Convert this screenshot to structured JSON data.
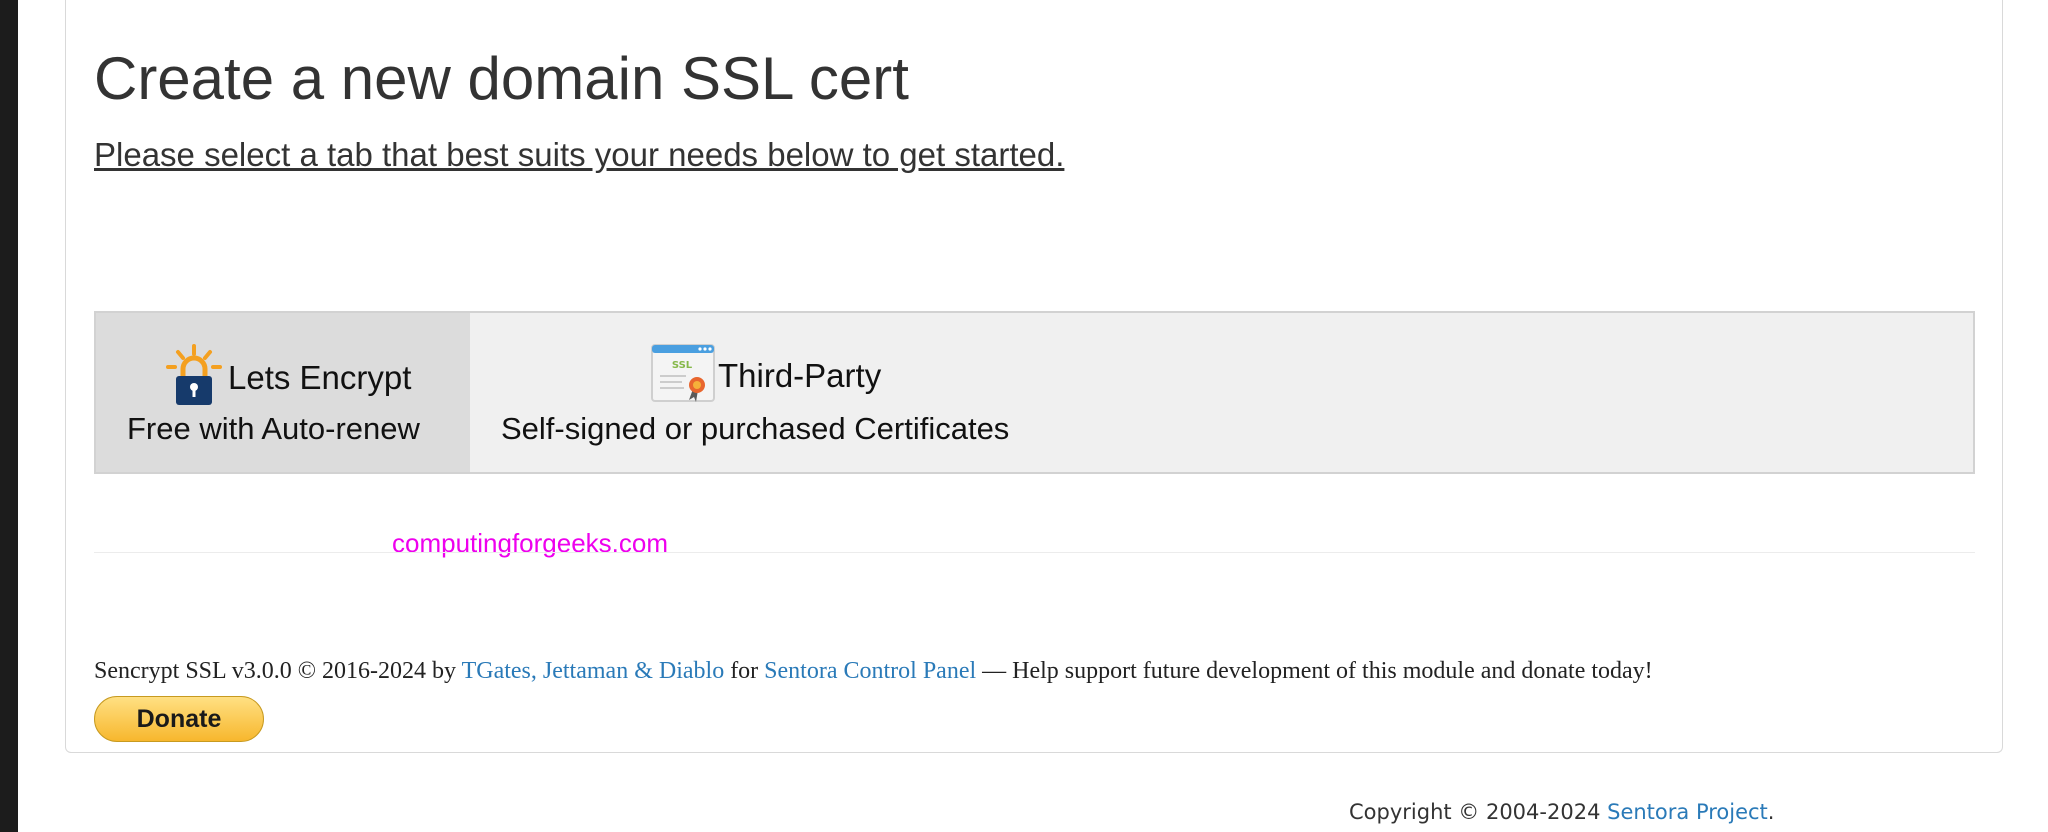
{
  "page": {
    "title": "Create a new domain SSL cert",
    "subtitle": "Please select a tab that best suits your needs below to get started."
  },
  "tabs": [
    {
      "title": "Lets Encrypt",
      "subtitle": "Free with Auto-renew",
      "icon": "lets-encrypt-lock-icon",
      "active": true
    },
    {
      "title": "Third-Party",
      "subtitle": "Self-signed or purchased Certificates",
      "icon": "ssl-certificate-icon",
      "active": false
    }
  ],
  "watermark": "computingforgeeks.com",
  "footer": {
    "product": "Sencrypt SSL v3.0.0 © 2016-2024 by",
    "authors_link": "TGates, Jettaman & Diablo",
    "for_text": "for",
    "panel_link": "Sentora Control Panel",
    "support_text": "— Help support future development of this module and donate today!",
    "donate_label": "Donate"
  },
  "copyright": {
    "text": "Copyright © 2004-2024",
    "link": "Sentora Project",
    "period": "."
  },
  "colors": {
    "link": "#2a7ab8",
    "watermark": "#ee00ee",
    "active_tab": "#dcdcdc",
    "tab_bar": "#f0f0f0",
    "donate": "#f7b72d"
  }
}
